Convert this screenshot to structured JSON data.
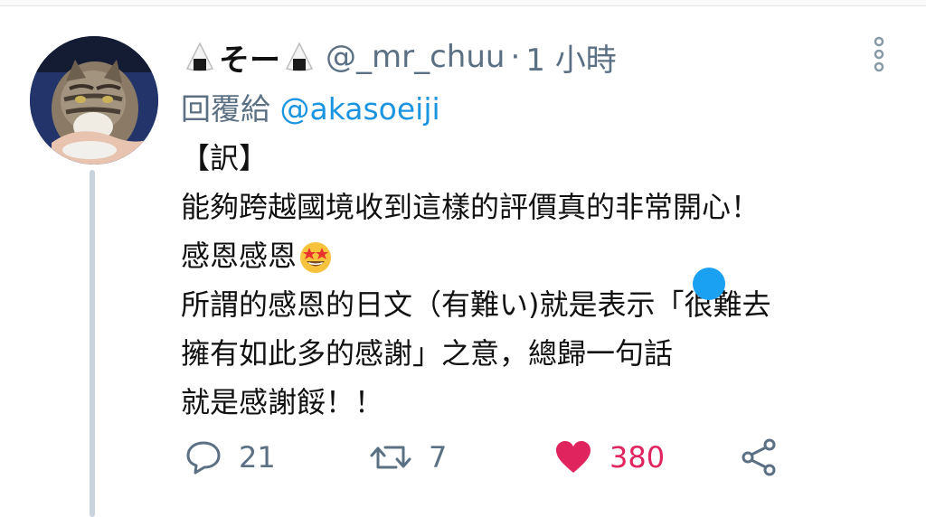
{
  "tweet": {
    "display_name": "そー",
    "handle": "@_mr_chuu",
    "separator": "·",
    "time": "1 小時",
    "reply_prefix": "回覆給",
    "reply_to": "@akasoeiji",
    "lines": [
      "【訳】",
      "能夠跨越國境收到這樣的評價真的非常開心！",
      "感恩感恩",
      "所謂的感恩的日文（有難い)就是表示「很難去",
      "擁有如此多的感謝」之意，總歸一句話",
      "就是感謝餒！！"
    ],
    "emoji": "star-struck-emoji"
  },
  "actions": {
    "reply_count": "21",
    "retweet_count": "7",
    "like_count": "380"
  },
  "colors": {
    "secondary_text": "#5b7083",
    "mention": "#1b95e0",
    "like": "#e0245e",
    "thread_line": "#c9d3de",
    "touch_indicator": "#1aa1f2"
  }
}
